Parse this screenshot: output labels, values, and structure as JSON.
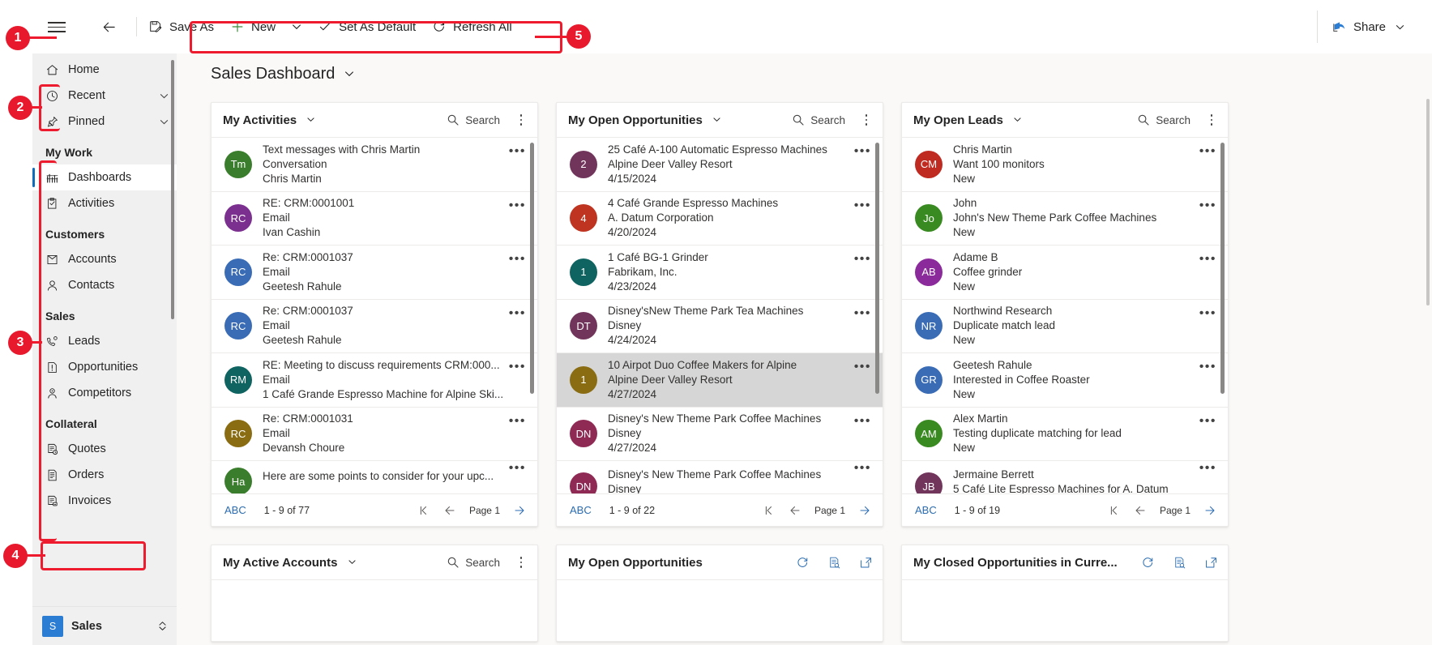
{
  "commandbar": {
    "back_icon": "back-arrow-icon",
    "items": [
      {
        "label": "Save As",
        "icon": "save-as-icon"
      },
      {
        "label": "New",
        "icon": "plus-icon",
        "has_caret": true
      },
      {
        "label": "Set As Default",
        "icon": "checkmark-icon"
      },
      {
        "label": "Refresh All",
        "icon": "refresh-icon"
      }
    ],
    "share_label": "Share",
    "share_icon": "share-icon"
  },
  "sidebar": {
    "top_items": [
      {
        "label": "Home",
        "icon": "home-icon",
        "expandable": false
      },
      {
        "label": "Recent",
        "icon": "clock-icon",
        "expandable": true
      },
      {
        "label": "Pinned",
        "icon": "pin-icon",
        "expandable": true
      }
    ],
    "groups": [
      {
        "title": "My Work",
        "items": [
          {
            "label": "Dashboards",
            "icon": "dashboard-icon",
            "selected": true
          },
          {
            "label": "Activities",
            "icon": "activities-icon",
            "selected": false
          }
        ]
      },
      {
        "title": "Customers",
        "items": [
          {
            "label": "Accounts",
            "icon": "accounts-icon",
            "selected": false
          },
          {
            "label": "Contacts",
            "icon": "contacts-icon",
            "selected": false
          }
        ]
      },
      {
        "title": "Sales",
        "items": [
          {
            "label": "Leads",
            "icon": "leads-icon",
            "selected": false
          },
          {
            "label": "Opportunities",
            "icon": "opportunities-icon",
            "selected": false
          },
          {
            "label": "Competitors",
            "icon": "competitors-icon",
            "selected": false
          }
        ]
      },
      {
        "title": "Collateral",
        "items": [
          {
            "label": "Quotes",
            "icon": "quotes-icon",
            "selected": false
          },
          {
            "label": "Orders",
            "icon": "orders-icon",
            "selected": false
          },
          {
            "label": "Invoices",
            "icon": "invoices-icon",
            "selected": false
          }
        ]
      }
    ],
    "area_switcher": {
      "badge": "S",
      "label": "Sales",
      "icon": "updown-chevron-icon"
    }
  },
  "page": {
    "title": "Sales Dashboard",
    "chevron": "chevron-down-icon"
  },
  "search_label": "Search",
  "cards": {
    "activities": {
      "title": "My Activities",
      "rows": [
        {
          "initials": "Tm",
          "color": "#3a7d2c",
          "l1": "Text messages with Chris Martin",
          "l2": "Conversation",
          "l3": "Chris Martin",
          "selected": false
        },
        {
          "initials": "RC",
          "color": "#7b2f8e",
          "l1": "RE: CRM:0001001",
          "l2": "Email",
          "l3": "Ivan Cashin",
          "selected": false
        },
        {
          "initials": "RC",
          "color": "#3a6cb5",
          "l1": "Re: CRM:0001037",
          "l2": "Email",
          "l3": "Geetesh Rahule",
          "selected": false
        },
        {
          "initials": "RC",
          "color": "#3a6cb5",
          "l1": "Re: CRM:0001037",
          "l2": "Email",
          "l3": "Geetesh Rahule",
          "selected": false
        },
        {
          "initials": "RM",
          "color": "#0f6360",
          "l1": "RE: Meeting to discuss requirements CRM:000...",
          "l2": "Email",
          "l3": "1 Café Grande Espresso Machine for Alpine Ski...",
          "selected": false
        },
        {
          "initials": "RC",
          "color": "#8a6d12",
          "l1": "Re: CRM:0001031",
          "l2": "Email",
          "l3": "Devansh Choure",
          "selected": false
        },
        {
          "initials": "Ha",
          "color": "#3a7d2c",
          "l1": "Here are some points to consider for your upc...",
          "l2": "",
          "l3": "",
          "selected": false
        }
      ],
      "footer": {
        "abc": "ABC",
        "count": "1 - 9 of 77",
        "page": "Page 1"
      }
    },
    "opportunities": {
      "title": "My Open Opportunities",
      "rows": [
        {
          "initials": "2",
          "color": "#71355b",
          "l1": "25 Café A-100 Automatic Espresso Machines",
          "l2": "Alpine Deer Valley Resort",
          "l3": "4/15/2024",
          "selected": false
        },
        {
          "initials": "4",
          "color": "#bf3420",
          "l1": "4 Café Grande Espresso Machines",
          "l2": "A. Datum Corporation",
          "l3": "4/20/2024",
          "selected": false
        },
        {
          "initials": "1",
          "color": "#0f6360",
          "l1": "1 Café BG-1 Grinder",
          "l2": "Fabrikam, Inc.",
          "l3": "4/23/2024",
          "selected": false
        },
        {
          "initials": "DT",
          "color": "#71355b",
          "l1": "Disney'sNew Theme Park Tea Machines",
          "l2": "Disney",
          "l3": "4/24/2024",
          "selected": false
        },
        {
          "initials": "1",
          "color": "#8a6d12",
          "l1": "10 Airpot Duo Coffee Makers for Alpine",
          "l2": "Alpine Deer Valley Resort",
          "l3": "4/27/2024",
          "selected": true
        },
        {
          "initials": "DN",
          "color": "#8f2a55",
          "l1": "Disney's New Theme Park Coffee Machines",
          "l2": "Disney",
          "l3": "4/27/2024",
          "selected": false
        },
        {
          "initials": "DN",
          "color": "#8f2a55",
          "l1": "Disney's New Theme Park Coffee Machines",
          "l2": "Disney",
          "l3": "",
          "selected": false
        }
      ],
      "footer": {
        "abc": "ABC",
        "count": "1 - 9 of 22",
        "page": "Page 1"
      }
    },
    "leads": {
      "title": "My Open Leads",
      "rows": [
        {
          "initials": "CM",
          "color": "#bf2a21",
          "l1": "Chris Martin",
          "l2": "Want 100 monitors",
          "l3": "New",
          "selected": false
        },
        {
          "initials": "Jo",
          "color": "#3a8a22",
          "l1": "John",
          "l2": "John's New Theme Park Coffee Machines",
          "l3": "New",
          "selected": false
        },
        {
          "initials": "AB",
          "color": "#8b2a9b",
          "l1": "Adame B",
          "l2": "Coffee grinder",
          "l3": "New",
          "selected": false
        },
        {
          "initials": "NR",
          "color": "#3a6cb5",
          "l1": "Northwind Research",
          "l2": "Duplicate match lead",
          "l3": "New",
          "selected": false
        },
        {
          "initials": "GR",
          "color": "#3a6cb5",
          "l1": "Geetesh Rahule",
          "l2": "Interested in Coffee Roaster",
          "l3": "New",
          "selected": false
        },
        {
          "initials": "AM",
          "color": "#3a8a22",
          "l1": "Alex Martin",
          "l2": "Testing duplicate matching for lead",
          "l3": "New",
          "selected": false
        },
        {
          "initials": "JB",
          "color": "#71355b",
          "l1": "Jermaine Berrett",
          "l2": "5 Café Lite Espresso Machines for A. Datum",
          "l3": "",
          "selected": false
        }
      ],
      "footer": {
        "abc": "ABC",
        "count": "1 - 9 of 19",
        "page": "Page 1"
      }
    },
    "accounts": {
      "title": "My Active Accounts",
      "has_search": true
    },
    "open_opportunities_chart": {
      "title": "My Open Opportunities",
      "actions": [
        "refresh-icon",
        "view-records-icon",
        "expand-icon"
      ]
    },
    "closed_opportunities_chart": {
      "title": "My Closed Opportunities in Curre...",
      "actions": [
        "refresh-icon",
        "view-records-icon",
        "expand-icon"
      ]
    }
  },
  "annotations": [
    {
      "number": "1",
      "target": "hamburger-menu"
    },
    {
      "number": "2",
      "target": "recent-pinned-group"
    },
    {
      "number": "3",
      "target": "sitemap-areas"
    },
    {
      "number": "4",
      "target": "area-switcher"
    },
    {
      "number": "5",
      "target": "command-bar"
    }
  ]
}
